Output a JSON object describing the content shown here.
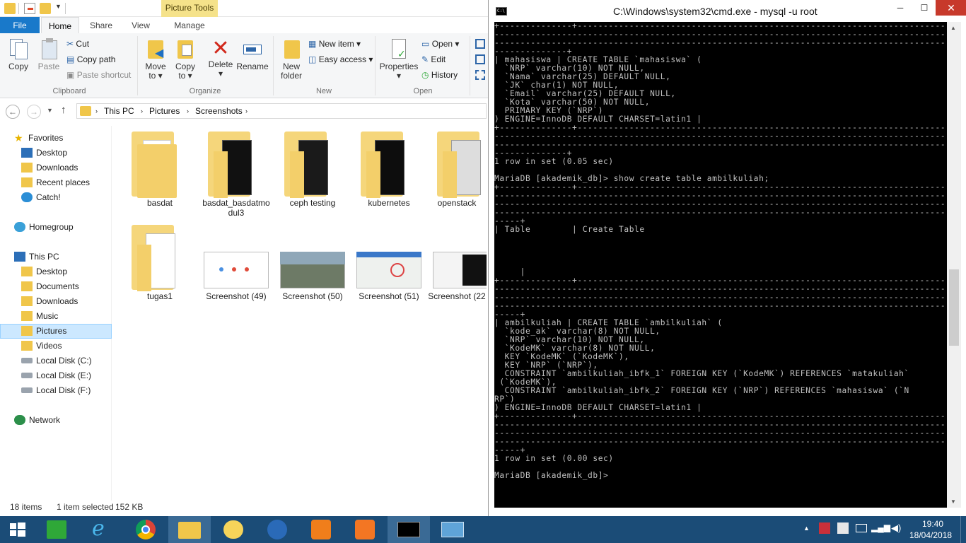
{
  "explorer": {
    "contextual_tab": "Picture Tools",
    "tabs": [
      "File",
      "Home",
      "Share",
      "View",
      "Manage"
    ],
    "ribbon": {
      "clipboard": {
        "copy": "Copy",
        "paste": "Paste",
        "cut": "Cut",
        "copy_path": "Copy path",
        "paste_shortcut": "Paste shortcut",
        "label": "Clipboard"
      },
      "organize": {
        "move_to_1": "Move",
        "move_to_2": "to ▾",
        "copy_to_1": "Copy",
        "copy_to_2": "to ▾",
        "delete_1": "Delete",
        "delete_2": "▾",
        "rename": "Rename",
        "label": "Organize"
      },
      "new": {
        "new_folder_1": "New",
        "new_folder_2": "folder",
        "new_item": "New item ▾",
        "easy_access": "Easy access ▾",
        "label": "New"
      },
      "open": {
        "properties_1": "Properties",
        "properties_2": "▾",
        "open": "Open ▾",
        "edit": "Edit",
        "history": "History",
        "label": "Open"
      }
    },
    "address": {
      "crumbs": [
        "This PC",
        "Pictures",
        "Screenshots"
      ]
    },
    "nav": {
      "favorites": "Favorites",
      "desktop": "Desktop",
      "downloads": "Downloads",
      "recent": "Recent places",
      "catch": "Catch!",
      "homegroup": "Homegroup",
      "thispc": "This PC",
      "pc_desktop": "Desktop",
      "documents": "Documents",
      "pc_downloads": "Downloads",
      "music": "Music",
      "pictures": "Pictures",
      "videos": "Videos",
      "disk_c": "Local Disk (C:)",
      "disk_e": "Local Disk (E:)",
      "disk_f": "Local Disk (F:)",
      "network": "Network"
    },
    "items": {
      "basdat": "basdat",
      "basdat_modul3_1": "basdat_basdatmo",
      "basdat_modul3_2": "dul3",
      "ceph": "ceph testing",
      "kubernetes": "kubernetes",
      "openstack": "openstack",
      "tugas1": "tugas1",
      "ss49": "Screenshot (49)",
      "ss50": "Screenshot (50)",
      "ss51": "Screenshot (51)",
      "ss52": "Screenshot (22"
    },
    "status": {
      "count": "18 items",
      "selected": "1 item selected",
      "size": "152 KB"
    }
  },
  "cmd": {
    "title": "C:\\Windows\\system32\\cmd.exe - mysql  -u root",
    "output": "+--------------+----------------------------------------------------------------------------------\n----------------------------------------------------------------------------------------------------\n----------------------------------------------------------------------------------------------------\n--------------+\n| mahasiswa | CREATE TABLE `mahasiswa` (\n  `NRP` varchar(10) NOT NULL,\n  `Nama` varchar(25) DEFAULT NULL,\n  `JK` char(1) NOT NULL,\n  `Email` varchar(25) DEFAULT NULL,\n  `Kota` varchar(50) NOT NULL,\n  PRIMARY KEY (`NRP`)\n) ENGINE=InnoDB DEFAULT CHARSET=latin1 |\n+--------------+----------------------------------------------------------------------------------\n----------------------------------------------------------------------------------------------------\n----------------------------------------------------------------------------------------------------\n--------------+\n1 row in set (0.05 sec)\n\nMariaDB [akademik_db]> show create table ambilkuliah;\n+--------------+----------------------------------------------------------------------------------\n----------------------------------------------------------------------------------------------------\n----------------------------------------------------------------------------------------------------\n----------------------------------------------------------------------------------------------------\n-----+\n| Table        | Create Table\n\n\n\n\n     |\n+--------------+----------------------------------------------------------------------------------\n----------------------------------------------------------------------------------------------------\n----------------------------------------------------------------------------------------------------\n----------------------------------------------------------------------------------------------------\n-----+\n| ambilkuliah | CREATE TABLE `ambilkuliah` (\n  `kode_ak` varchar(8) NOT NULL,\n  `NRP` varchar(10) NOT NULL,\n  `KodeMK` varchar(8) NOT NULL,\n  KEY `KodeMK` (`KodeMK`),\n  KEY `NRP` (`NRP`),\n  CONSTRAINT `ambilkuliah_ibfk_1` FOREIGN KEY (`KodeMK`) REFERENCES `matakuliah`\n (`KodeMK`),\n  CONSTRAINT `ambilkuliah_ibfk_2` FOREIGN KEY (`NRP`) REFERENCES `mahasiswa` (`N\nRP`)\n) ENGINE=InnoDB DEFAULT CHARSET=latin1 |\n+--------------+----------------------------------------------------------------------------------\n----------------------------------------------------------------------------------------------------\n----------------------------------------------------------------------------------------------------\n----------------------------------------------------------------------------------------------------\n-----+\n1 row in set (0.00 sec)\n\nMariaDB [akademik_db]>"
  },
  "taskbar": {
    "time": "19:40",
    "date": "18/04/2018"
  },
  "colors": {
    "taskbar": "#1b4c77",
    "file_tab": "#1979ca",
    "selection": "#cce8ff",
    "folder": "#f5d67b",
    "picture_tools": "#f5e28a"
  }
}
